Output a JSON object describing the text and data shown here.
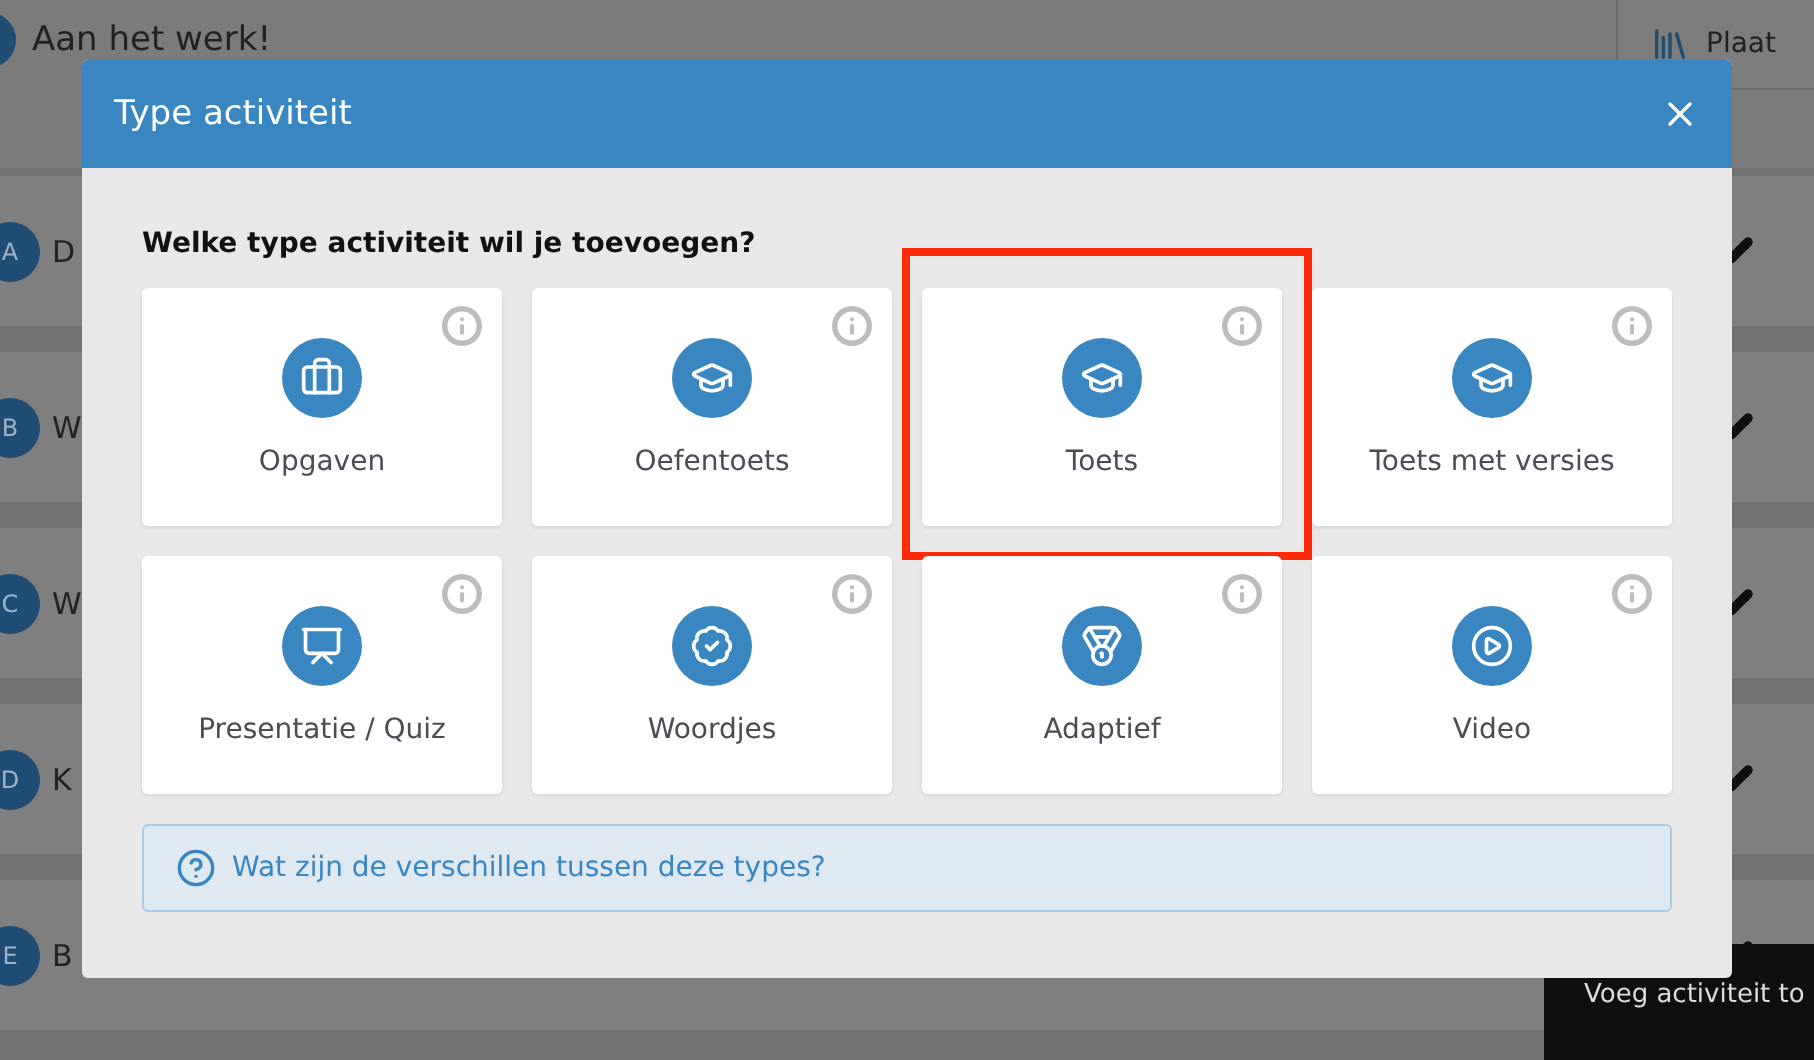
{
  "background": {
    "header": {
      "title": "Aan het werk!"
    },
    "side_panel": {
      "label": "Plaat"
    },
    "rows": [
      {
        "letter": "A",
        "title": "D"
      },
      {
        "letter": "B",
        "title": "W"
      },
      {
        "letter": "C",
        "title": "W"
      },
      {
        "letter": "D",
        "title": "K"
      },
      {
        "letter": "E",
        "title": "B"
      }
    ],
    "tooltip": "Voeg activiteit to"
  },
  "dialog": {
    "title": "Type activiteit",
    "question": "Welke type activiteit wil je toevoegen?",
    "types": [
      {
        "label": "Opgaven",
        "kind": "briefcase",
        "highlighted": false
      },
      {
        "label": "Oefentoets",
        "kind": "cap",
        "highlighted": false
      },
      {
        "label": "Toets",
        "kind": "cap",
        "highlighted": true
      },
      {
        "label": "Toets met versies",
        "kind": "cap",
        "highlighted": false
      },
      {
        "label": "Presentatie / Quiz",
        "kind": "easel",
        "highlighted": false
      },
      {
        "label": "Woordjes",
        "kind": "badge",
        "highlighted": false
      },
      {
        "label": "Adaptief",
        "kind": "medal",
        "highlighted": false
      },
      {
        "label": "Video",
        "kind": "play",
        "highlighted": false
      }
    ],
    "help_link": "Wat zijn de verschillen tussen deze types?"
  }
}
